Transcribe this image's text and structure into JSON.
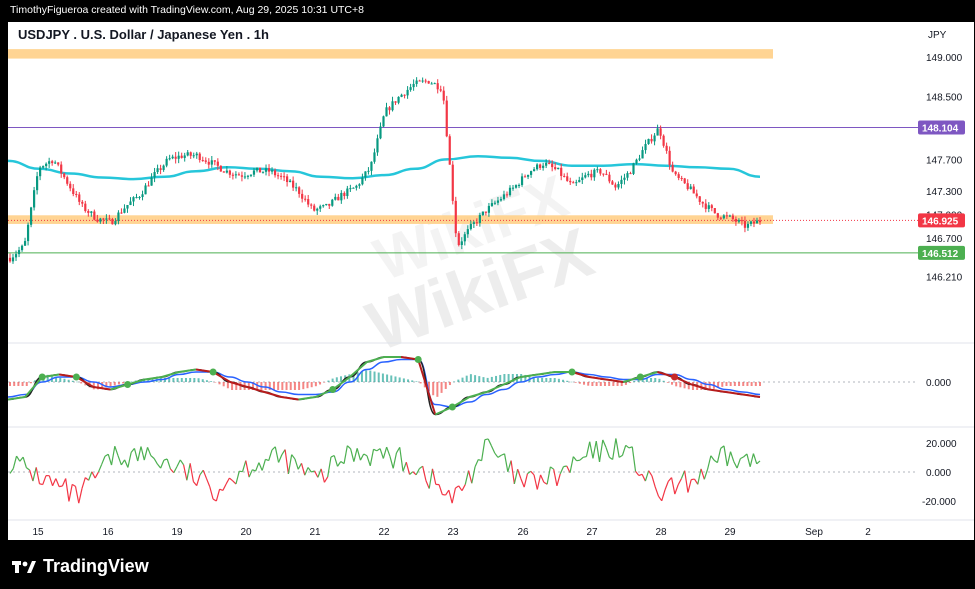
{
  "header": {
    "credit": "TimothyFigueroa created with TradingView.com, Aug 29, 2025 10:31 UTC+8"
  },
  "footer": {
    "logo_text": "TradingView"
  },
  "watermark": {
    "text": "WikiFX"
  },
  "colors": {
    "candle_up": "#089981",
    "candle_down": "#f23645",
    "sma": "#26c6da",
    "zone": "#ffcc80",
    "resistance_line": "#7e57c2",
    "support_line": "#4caf50",
    "macd_line": "#2962ff",
    "signal_line": "#ff6d00",
    "histogram_up": "#26a69a",
    "histogram_down": "#ef5350",
    "osc_up": "#4caf50",
    "osc_down": "#f23645"
  },
  "chart_data": [
    {
      "type": "candlestick",
      "title": "USDJPY . U.S. Dollar / Japanese Yen . 1h",
      "currency": "JPY",
      "x_ticks": [
        "15",
        "16",
        "19",
        "20",
        "21",
        "22",
        "23",
        "26",
        "27",
        "28",
        "29",
        "Sep",
        "2"
      ],
      "y_ticks": [
        146.21,
        146.7,
        147.0,
        147.3,
        147.7,
        148.5,
        149.0
      ],
      "y_tick_labels": [
        "146.210",
        "146.700",
        "147.000",
        "147.300",
        "147.700",
        "148.500",
        "149.000"
      ],
      "ylim": [
        146.05,
        149.2
      ],
      "price_labels": [
        {
          "value": "148.104",
          "color": "#7e57c2"
        },
        {
          "value": "146.925",
          "color": "#f23645"
        },
        {
          "value": "146.512",
          "color": "#4caf50"
        }
      ],
      "zones": [
        {
          "from": 148.98,
          "to": 149.1
        },
        {
          "from": 146.88,
          "to": 146.99
        }
      ],
      "hlines": [
        {
          "value": 148.104,
          "color": "#7e57c2"
        },
        {
          "value": 146.512,
          "color": "#4caf50"
        }
      ],
      "sma_anchor_values": [
        147.68,
        147.58,
        147.52,
        147.47,
        147.45,
        147.48,
        147.55,
        147.6,
        147.58,
        147.55,
        147.48,
        147.46,
        147.5,
        147.58,
        147.7,
        147.74,
        147.72,
        147.68,
        147.62,
        147.62,
        147.64,
        147.62,
        147.6,
        147.58,
        147.48
      ],
      "candle_anchor_values": [
        146.45,
        146.6,
        147.6,
        147.7,
        147.4,
        147.1,
        146.95,
        146.9,
        147.1,
        147.25,
        147.5,
        147.7,
        147.75,
        147.75,
        147.65,
        147.55,
        147.5,
        147.55,
        147.55,
        147.45,
        147.3,
        147.05,
        147.1,
        147.25,
        147.35,
        147.6,
        148.3,
        148.5,
        148.65,
        148.7,
        148.6,
        146.6,
        146.85,
        147.05,
        147.2,
        147.35,
        147.55,
        147.65,
        147.55,
        147.35,
        147.5,
        147.55,
        147.35,
        147.55,
        147.85,
        148.1,
        147.5,
        147.35,
        147.15,
        147.0,
        146.95,
        146.85,
        146.92
      ]
    },
    {
      "type": "line",
      "series": [
        {
          "values": [
            -0.07,
            -0.06,
            0.02,
            0.03,
            0.02,
            -0.02,
            -0.03,
            -0.01,
            0.01,
            0.02,
            0.04,
            0.05,
            0.04,
            0.0,
            -0.02,
            -0.04,
            -0.06,
            -0.07,
            -0.06,
            -0.03,
            0.02,
            0.08,
            0.1,
            0.1,
            0.09,
            -0.13,
            -0.1,
            -0.06,
            -0.04,
            -0.01,
            0.02,
            0.03,
            0.04,
            0.04,
            0.02,
            0.01,
            0.0,
            0.02,
            0.04,
            0.02,
            -0.01,
            -0.03,
            -0.04,
            -0.05,
            -0.06
          ]
        },
        {
          "values": [
            -0.06,
            -0.05,
            0.0,
            0.02,
            0.02,
            0.0,
            -0.02,
            -0.01,
            0.0,
            0.01,
            0.03,
            0.04,
            0.04,
            0.02,
            0.0,
            -0.02,
            -0.04,
            -0.05,
            -0.05,
            -0.04,
            0.0,
            0.05,
            0.08,
            0.09,
            0.09,
            -0.09,
            -0.1,
            -0.08,
            -0.05,
            -0.03,
            0.0,
            0.02,
            0.03,
            0.04,
            0.03,
            0.02,
            0.01,
            0.01,
            0.03,
            0.03,
            0.01,
            -0.01,
            -0.03,
            -0.04,
            -0.05
          ]
        }
      ],
      "y_tick_labels": [
        "0.000"
      ],
      "ylim": [
        -0.15,
        0.15
      ]
    },
    {
      "type": "line",
      "y_tick_labels": [
        "20.000",
        "0.000",
        "-20.000"
      ],
      "ylim": [
        -26,
        28
      ]
    }
  ],
  "x_label_text": [
    "15",
    "16",
    "19",
    "20",
    "21",
    "22",
    "23",
    "26",
    "27",
    "28",
    "29",
    "Sep",
    "2"
  ]
}
